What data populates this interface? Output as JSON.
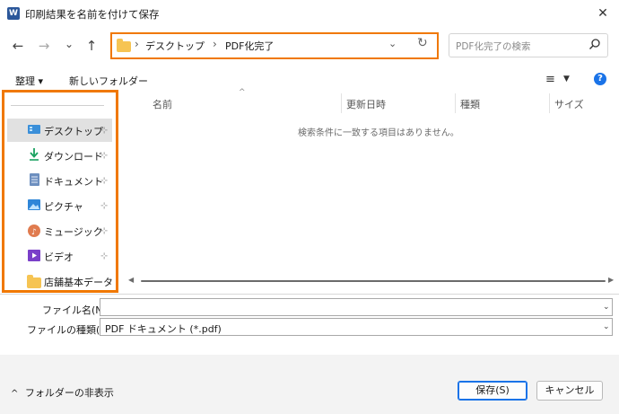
{
  "window": {
    "app_icon_letter": "W",
    "title": "印刷結果を名前を付けて保存",
    "close_glyph": "✕"
  },
  "nav": {
    "back": "←",
    "forward": "→",
    "recent": "⌄",
    "up": "↑"
  },
  "address": {
    "crumbs": [
      "デスクトップ",
      "PDF化完了"
    ],
    "separator": "›",
    "dropdown_glyph": "⌄",
    "refresh_glyph": "↻"
  },
  "search": {
    "placeholder": "PDF化完了の検索"
  },
  "toolbar": {
    "organize": "整理 ▾",
    "new_folder": "新しいフォルダー",
    "view_glyph": "≡",
    "view_chev": "▼",
    "help": "?"
  },
  "sidebar": {
    "items": [
      {
        "label": "デスクトップ",
        "icon": "desktop-icon",
        "pinned": true
      },
      {
        "label": "ダウンロード",
        "icon": "download-icon",
        "pinned": true
      },
      {
        "label": "ドキュメント",
        "icon": "document-icon",
        "pinned": true
      },
      {
        "label": "ピクチャ",
        "icon": "pictures-icon",
        "pinned": true
      },
      {
        "label": "ミュージック",
        "icon": "music-icon",
        "pinned": true
      },
      {
        "label": "ビデオ",
        "icon": "video-icon",
        "pinned": true
      },
      {
        "label": "店舗基本データ",
        "icon": "folder-icon",
        "pinned": false
      }
    ],
    "pin_glyph": "📌"
  },
  "file_list": {
    "columns": [
      "名前",
      "更新日時",
      "種類",
      "サイズ"
    ],
    "empty_message": "検索条件に一致する項目はありません。",
    "sort_glyph": "^"
  },
  "form": {
    "filename_label": "ファイル名(N):",
    "filename_value": "",
    "filetype_label": "ファイルの種類(T):",
    "filetype_value": "PDF ドキュメント (*.pdf)"
  },
  "footer": {
    "hide_folders": "フォルダーの非表示",
    "hide_glyph": "^",
    "save": "保存(S)",
    "cancel": "キャンセル"
  },
  "colors": {
    "highlight": "#f07800",
    "accent": "#1a73e8",
    "folder": "#f6c453"
  }
}
